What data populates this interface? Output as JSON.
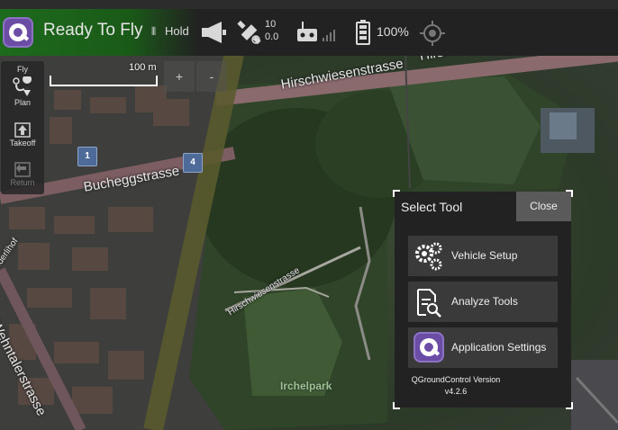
{
  "toolbar": {
    "status": "Ready To Fly",
    "flight_mode": "Hold",
    "satellite_count": "10",
    "hdop": "0.0",
    "battery": "100%",
    "colors": {
      "status_green": "#1d6b1d",
      "toolbar_bg": "#222222",
      "logo_purple": "#6b4da5"
    }
  },
  "toolstrip": {
    "fly": "Fly",
    "plan": "Plan",
    "takeoff": "Takeoff",
    "return": "Return"
  },
  "map": {
    "scale": "100 m",
    "zoom_in": "+",
    "zoom_out": "-",
    "streets": {
      "hirschwiesen_top": "Hirschwiesenstrasse",
      "hirschwiesen_top_end": "Hirsc",
      "hirschwiesen_mid": "Hirschwiesenstrasse",
      "hirschwiesen_diag": "Hirschwiesenstrasse",
      "bucheggstrasse": "Bucheggstrasse",
      "wehntalerstrasse": "Wehntalerstrasse",
      "laderlihof": "ederlihof"
    },
    "park": "Irchelpark",
    "markers": [
      "1",
      "4"
    ]
  },
  "dialog": {
    "title": "Select Tool",
    "close": "Close",
    "buttons": {
      "vehicle_setup": "Vehicle Setup",
      "analyze_tools": "Analyze Tools",
      "app_settings": "Application Settings"
    },
    "version_line1": "QGroundControl Version",
    "version_line2": "v4.2.6"
  }
}
